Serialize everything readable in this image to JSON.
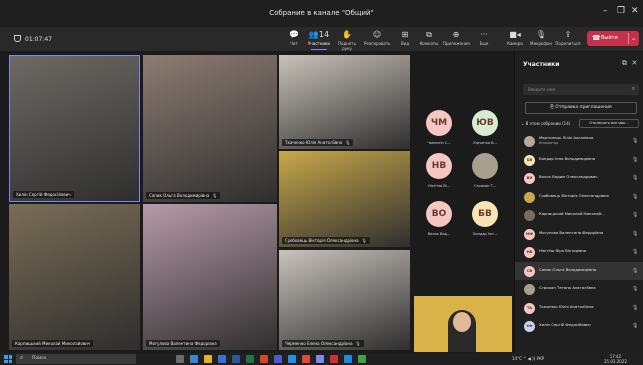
{
  "window": {
    "title": "Собрание в канале \"Общий\"",
    "controls": [
      "–",
      "❐",
      "✕"
    ]
  },
  "toolbar": {
    "timer": "01:07:47",
    "buttons": [
      {
        "label": "Чат",
        "icon": "chat-icon",
        "glyph": "💬"
      },
      {
        "label": "Участники",
        "icon": "participants-icon",
        "glyph": "👥14",
        "active": true
      },
      {
        "label": "Поднять руку",
        "icon": "raise-hand-icon",
        "glyph": "✋"
      },
      {
        "label": "Реагировать",
        "icon": "react-icon",
        "glyph": "☺"
      },
      {
        "label": "Вид",
        "icon": "view-icon",
        "glyph": "⊞"
      },
      {
        "label": "Комнаты",
        "icon": "rooms-icon",
        "glyph": "⧉"
      },
      {
        "label": "Приложения",
        "icon": "apps-icon",
        "glyph": "⊕"
      },
      {
        "label": "Еще",
        "icon": "more-icon",
        "glyph": "···"
      },
      {
        "label": "Камера",
        "icon": "camera-icon",
        "glyph": "■◂"
      },
      {
        "label": "Микрофон",
        "icon": "microphone-icon",
        "glyph": "🎙"
      },
      {
        "label": "Поделиться",
        "icon": "share-icon",
        "glyph": "⇪"
      }
    ],
    "leave_label": "Выйти",
    "leave_color": "#c4314b"
  },
  "stage": {
    "tiles": [
      {
        "name": "Хилін Сергій Федосійович",
        "bg": "#6d6a64"
      },
      {
        "name": "Сапик Ольга Володимирівна",
        "bg": "#8d7c73"
      },
      {
        "name": "Ткаченко Юлія Анатоліївна",
        "bg": "#c9c2ba"
      },
      {
        "name": "Гробовець Вікторія Олександрівна",
        "bg": "#c7a84a"
      },
      {
        "name": "Карпицький Миколай Миколайович",
        "bg": "#7a6d57"
      },
      {
        "name": "Могулова Валентина Федорівна",
        "bg": "#b79aa7"
      },
      {
        "name": "Черменко Елена Олександрівна",
        "bg": "#c9c3bd"
      }
    ],
    "avatars": [
      {
        "initials": "ЧМ",
        "name": "Чаплигін С...",
        "color": "#f4c7c2"
      },
      {
        "initials": "ЮВ",
        "name": "Юрченко В...",
        "color": "#d6ecd2"
      },
      {
        "initials": "НВ",
        "name": "Нікітіна Ві...",
        "color": "#f4c7c2"
      },
      {
        "initials": "",
        "name": "Стрикан Т...",
        "color": "#a8a08e"
      },
      {
        "initials": "ВО",
        "name": "Волок Вад...",
        "color": "#f4c7c2"
      },
      {
        "initials": "БВ",
        "name": "Бондар Інн...",
        "color": "#f7e3b3"
      }
    ]
  },
  "panel": {
    "title": "Участники",
    "search_placeholder": "Введите имя",
    "invite_label": "Отправка приглашения",
    "in_meeting_label": "В этом собрании (14)",
    "mute_all_label": "Отключить все мик...",
    "participants": [
      {
        "name": "Мартинець Лілія Ахсанівна",
        "role": "Инициатор",
        "initials": "",
        "color": "#b6a89a"
      },
      {
        "name": "Бондар Інна Володимирівна",
        "role": "",
        "initials": "БВ",
        "color": "#f7e3b3"
      },
      {
        "name": "Волох Вадим Олександрович",
        "role": "",
        "initials": "ВО",
        "color": "#f4c7c2"
      },
      {
        "name": "Гробовець Вікторія Олександрівна",
        "role": "",
        "initials": "",
        "color": "#c7a84a"
      },
      {
        "name": "Карпицький Миколай Миколай...",
        "role": "",
        "initials": "",
        "color": "#7a6d57"
      },
      {
        "name": "Могулова Валентина Федорівна",
        "role": "",
        "initials": "МФ",
        "color": "#f4c7c2"
      },
      {
        "name": "Нікітіна Віра Вікторівна",
        "role": "",
        "initials": "НВ",
        "color": "#f4c7c2"
      },
      {
        "name": "Сапик Ольга Володимирівна",
        "role": "",
        "initials": "СВ",
        "color": "#f4c7c2",
        "highlight": true
      },
      {
        "name": "Стрикан Тетяна Анатоліївна",
        "role": "",
        "initials": "",
        "color": "#a8a08e"
      },
      {
        "name": "Ткаченко Юлія Анатоліївна",
        "role": "",
        "initials": "ТА",
        "color": "#f4c7c2"
      },
      {
        "name": "Хилін Сергій Федосійович",
        "role": "",
        "initials": "ХФ",
        "color": "#c9d4ef"
      }
    ]
  },
  "taskbar": {
    "search_placeholder": "Поиск",
    "tray": "14°C  ^  ◀ ))  УКР",
    "time": "17:42",
    "date": "25.03.2022"
  }
}
